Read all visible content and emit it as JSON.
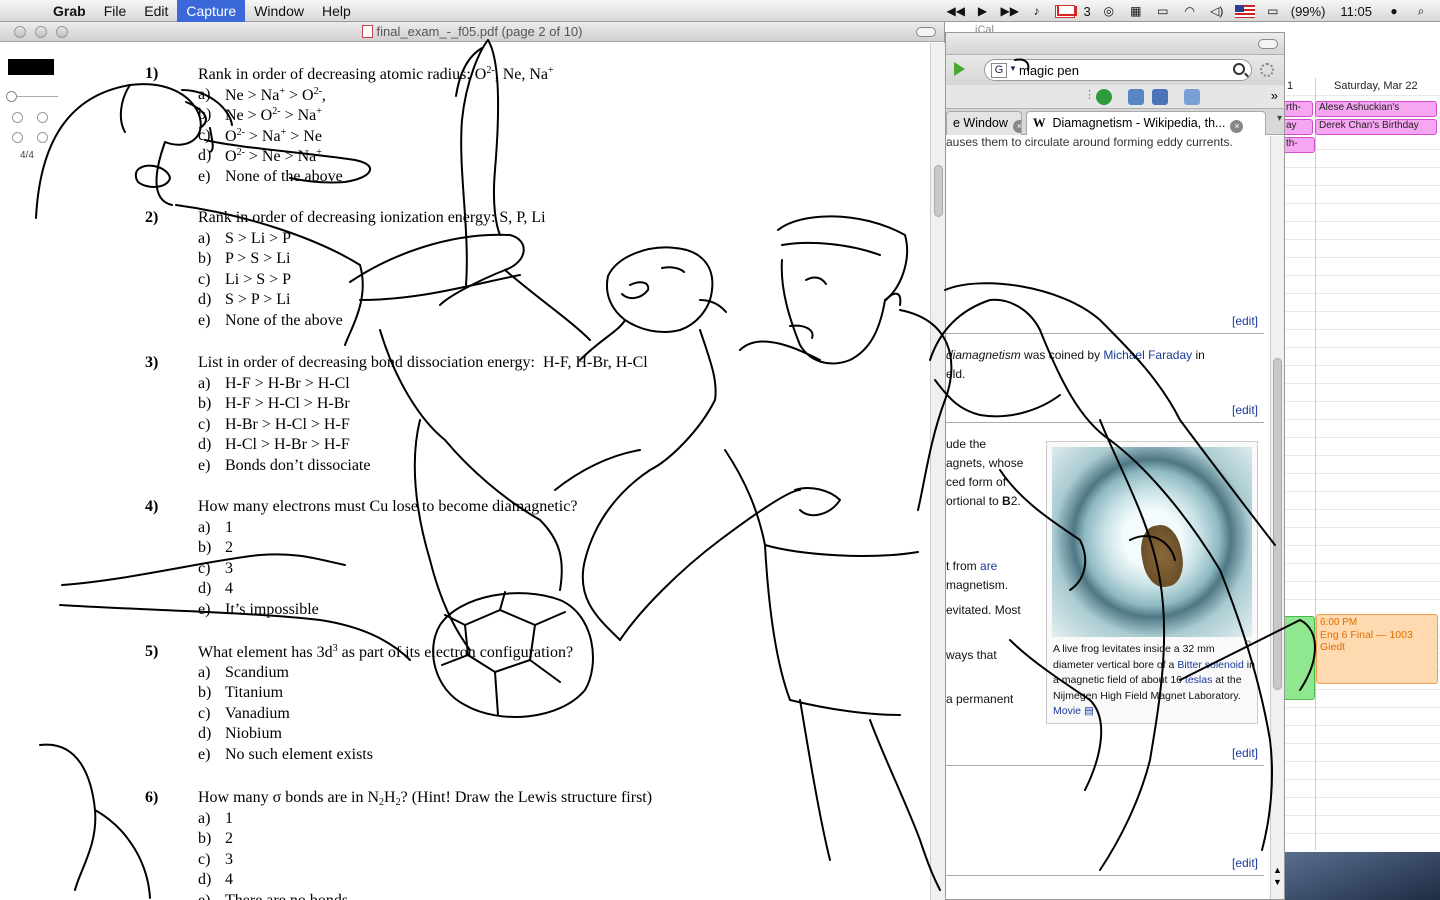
{
  "menubar": {
    "app_name": "Grab",
    "items": [
      "File",
      "Edit",
      "Capture",
      "Window",
      "Help"
    ],
    "active": "Capture",
    "gmail_count": "3",
    "battery": "(99%)",
    "clock": "11:05"
  },
  "pdf": {
    "window_title": "final_exam_-_f05.pdf (page 2 of 10)",
    "page_count": "4/4",
    "questions": [
      {
        "number": "1)",
        "html": "Rank in order of decreasing atomic radius: O<sup>2-</sup>, Ne, Na<sup>+</sup>",
        "options": [
          [
            "a)",
            "Ne &gt; Na<sup>+</sup> &gt; O<sup>2-</sup>,"
          ],
          [
            "b)",
            "Ne &gt; O<sup>2-</sup> &gt; Na<sup>+</sup>"
          ],
          [
            "c)",
            "O<sup>2-</sup> &gt; Na<sup>+</sup> &gt; Ne"
          ],
          [
            "d)",
            "O<sup>2-</sup> &gt; Ne &gt; Na<sup>+</sup>"
          ],
          [
            "e)",
            "None of the above"
          ]
        ]
      },
      {
        "number": "2)",
        "html": "Rank in order of decreasing ionization energy: S, P, Li",
        "options": [
          [
            "a)",
            "S &gt; Li &gt; P"
          ],
          [
            "b)",
            "P &gt; S &gt; Li"
          ],
          [
            "c)",
            "Li &gt; S &gt; P"
          ],
          [
            "d)",
            "S &gt; P &gt; Li"
          ],
          [
            "e)",
            "None of the above"
          ]
        ]
      },
      {
        "number": "3)",
        "html": "List in order of decreasing bond dissociation energy:&nbsp; H-F, H-Br, H-Cl",
        "options": [
          [
            "a)",
            "H-F &gt; H-Br &gt; H-Cl"
          ],
          [
            "b)",
            "H-F &gt; H-Cl &gt; H-Br"
          ],
          [
            "c)",
            "H-Br &gt; H-Cl &gt; H-F"
          ],
          [
            "d)",
            "H-Cl &gt; H-Br &gt; H-F"
          ],
          [
            "e)",
            "Bonds don’t dissociate"
          ]
        ]
      },
      {
        "number": "4)",
        "html": "How many electrons must Cu lose to become diamagnetic?",
        "options": [
          [
            "a)",
            "1"
          ],
          [
            "b)",
            "2"
          ],
          [
            "c)",
            "3"
          ],
          [
            "d)",
            "4"
          ],
          [
            "e)",
            "It’s impossible"
          ]
        ]
      },
      {
        "number": "5)",
        "html": "What element has 3d<sup>3</sup> as part of its electron configuration?",
        "options": [
          [
            "a)",
            "Scandium"
          ],
          [
            "b)",
            "Titanium"
          ],
          [
            "c)",
            "Vanadium"
          ],
          [
            "d)",
            "Niobium"
          ],
          [
            "e)",
            "No such element exists"
          ]
        ]
      },
      {
        "number": "6)",
        "html": "How many σ bonds are in N<sub>2</sub>H<sub>2</sub>? (Hint! Draw the Lewis structure first)",
        "options": [
          [
            "a)",
            "1"
          ],
          [
            "b)",
            "2"
          ],
          [
            "c)",
            "3"
          ],
          [
            "d)",
            "4"
          ],
          [
            "e)",
            "There are no bonds"
          ]
        ]
      }
    ]
  },
  "browser": {
    "search_value": "magic pen",
    "tabs": [
      {
        "label": "e Window"
      },
      {
        "label": "Diamagnetism - Wikipedia, th..."
      }
    ],
    "edit_label": "[edit]",
    "text": {
      "top_clip": "auses them to circulate around forming eddy currents.",
      "coined_a": "diamagnetism",
      "coined_b": " was coined by ",
      "coined_link": "Michael Faraday",
      "coined_c": " in",
      "coined_d": "eld.",
      "l1": "ude the",
      "l2": "agnets, whose",
      "l3": "ced form of",
      "l4": "ortional to ",
      "l4b": "B",
      "l4c": "2.",
      "l5a": "t from ",
      "l5b": "are",
      "l6": "magnetism.",
      "l7": "evitated. Most",
      "l8": "ways that",
      "l9": "a permanent"
    },
    "caption": {
      "a": "A live frog levitates inside a 32 mm diameter vertical bore of a ",
      "link1": "Bitter solenoid",
      "b": " in a magnetic field of about 16 ",
      "link2": "teslas",
      "c": " at the Nijmegen High Field Magnet Laboratory. ",
      "link3": "Movie"
    }
  },
  "ical": {
    "window_title": "iCal",
    "column_head": "Saturday, Mar 22",
    "prev_col": "1",
    "events": [
      {
        "label": "Alese Ashuckian's"
      },
      {
        "label": "Derek Chan's Birthday"
      },
      {
        "label": "rth-"
      },
      {
        "label": "ay"
      },
      {
        "label": "th-"
      },
      {
        "time": "6:00 PM",
        "label": "Eng 6 Final — 1003 Giedt"
      }
    ]
  }
}
